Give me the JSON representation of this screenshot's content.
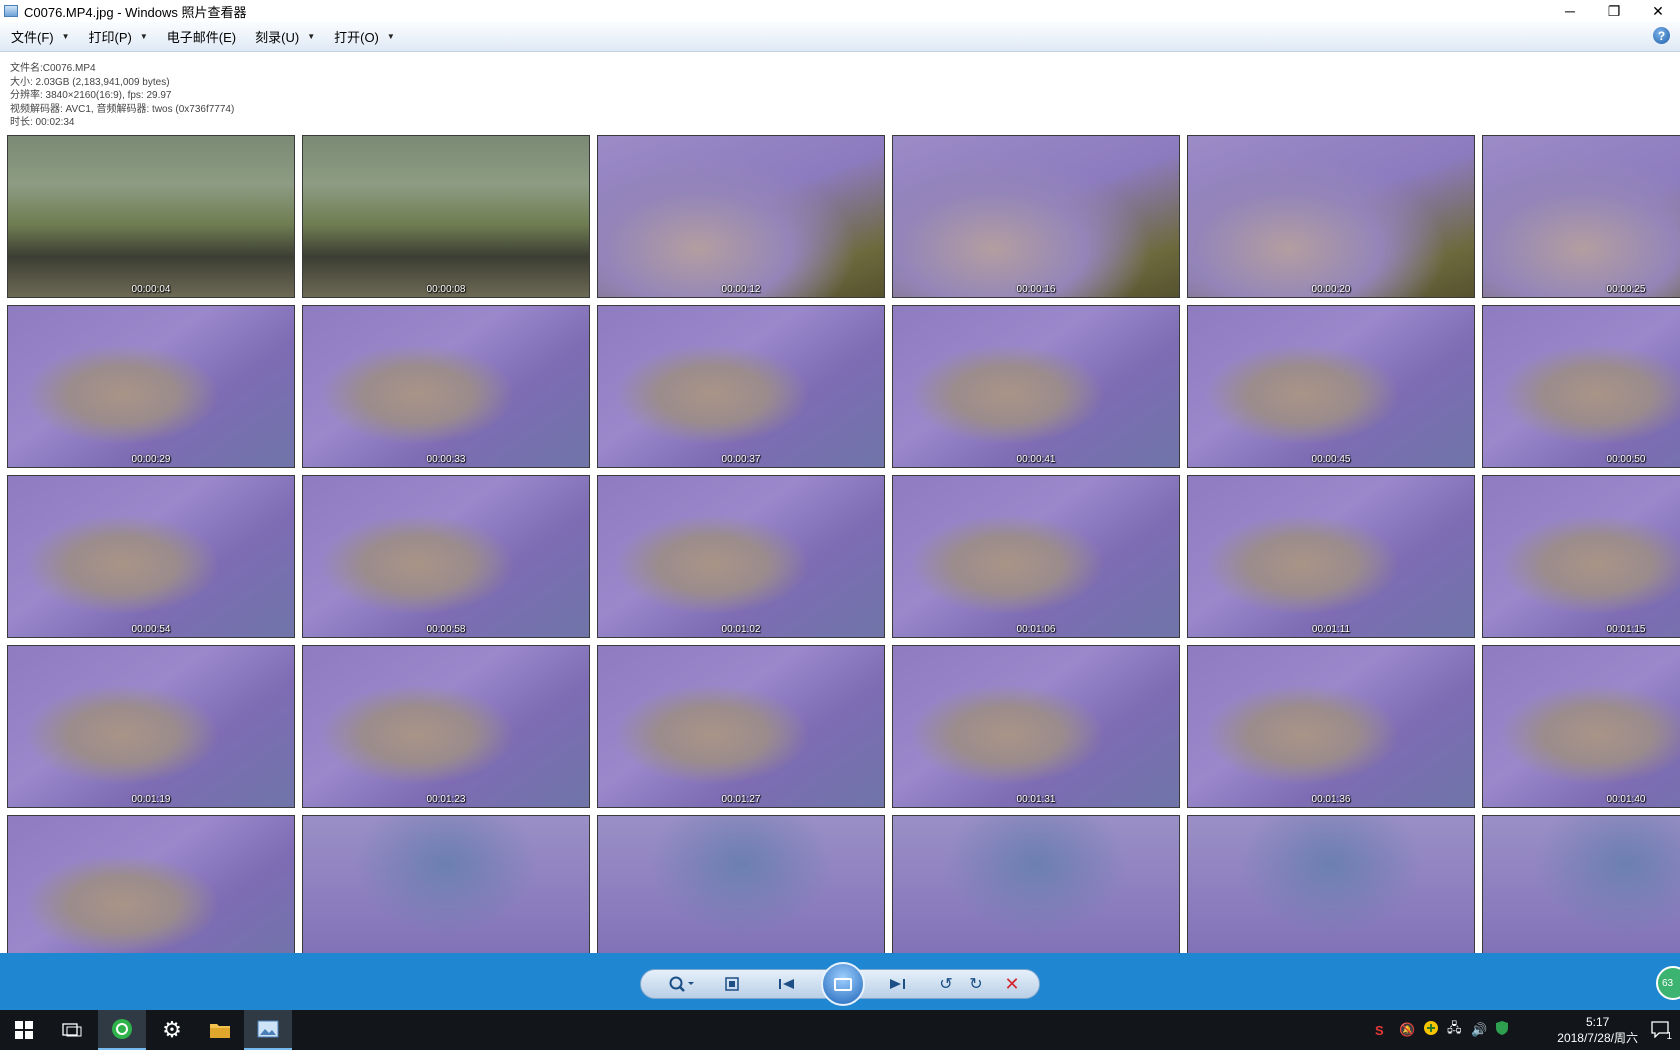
{
  "window": {
    "title": "C0076.MP4.jpg - Windows 照片查看器",
    "minimize_glyph": "─",
    "restore_glyph": "❐",
    "close_glyph": "✕"
  },
  "menu": {
    "items": [
      {
        "label": "文件(F)",
        "dropdown": true
      },
      {
        "label": "打印(P)",
        "dropdown": true
      },
      {
        "label": "电子邮件(E)",
        "dropdown": false
      },
      {
        "label": "刻录(U)",
        "dropdown": true
      },
      {
        "label": "打开(O)",
        "dropdown": true
      }
    ],
    "help_glyph": "?"
  },
  "info": {
    "filename": "文件名:C0076.MP4",
    "size": "大小: 2.03GB (2,183,941,009 bytes)",
    "resolution": "分辨率: 3840×2160(16:9), fps: 29.97",
    "codec": "视频解码器: AVC1, 音频解码器: twos (0x736f7774)",
    "duration": "时长: 00:02:34"
  },
  "thumbnails": [
    {
      "time": "00:00:04",
      "scene": "park"
    },
    {
      "time": "00:00:08",
      "scene": "park"
    },
    {
      "time": "00:00:12",
      "scene": "grass"
    },
    {
      "time": "00:00:16",
      "scene": "grass"
    },
    {
      "time": "00:00:20",
      "scene": "grass"
    },
    {
      "time": "00:00:25",
      "scene": "grass"
    },
    {
      "time": "00:00:29",
      "scene": "blanket"
    },
    {
      "time": "00:00:33",
      "scene": "blanket"
    },
    {
      "time": "00:00:37",
      "scene": "blanket"
    },
    {
      "time": "00:00:41",
      "scene": "blanket"
    },
    {
      "time": "00:00:45",
      "scene": "blanket"
    },
    {
      "time": "00:00:50",
      "scene": "blanket"
    },
    {
      "time": "00:00:54",
      "scene": "blanket"
    },
    {
      "time": "00:00:58",
      "scene": "blanket"
    },
    {
      "time": "00:01:02",
      "scene": "blanket"
    },
    {
      "time": "00:01:06",
      "scene": "blanket"
    },
    {
      "time": "00:01:11",
      "scene": "blanket"
    },
    {
      "time": "00:01:15",
      "scene": "blanket"
    },
    {
      "time": "00:01:19",
      "scene": "blanket"
    },
    {
      "time": "00:01:23",
      "scene": "blanket"
    },
    {
      "time": "00:01:27",
      "scene": "blanket"
    },
    {
      "time": "00:01:31",
      "scene": "blanket"
    },
    {
      "time": "00:01:36",
      "scene": "blanket"
    },
    {
      "time": "00:01:40",
      "scene": "blanket"
    },
    {
      "time": "",
      "scene": "blanket"
    },
    {
      "time": "",
      "scene": "legs"
    },
    {
      "time": "",
      "scene": "legs"
    },
    {
      "time": "",
      "scene": "legs"
    },
    {
      "time": "",
      "scene": "legs"
    },
    {
      "time": "",
      "scene": "legs"
    }
  ],
  "viewer": {
    "badge_text": "63"
  },
  "taskbar": {
    "time": "5:17",
    "date": "2018/7/28/周六",
    "notification_count": "1"
  },
  "colors": {
    "viewer_bar": "#1f87d2",
    "taskbar": "#12161b",
    "blanket": "#8f7cc0",
    "grass": "#6e6a3e"
  }
}
